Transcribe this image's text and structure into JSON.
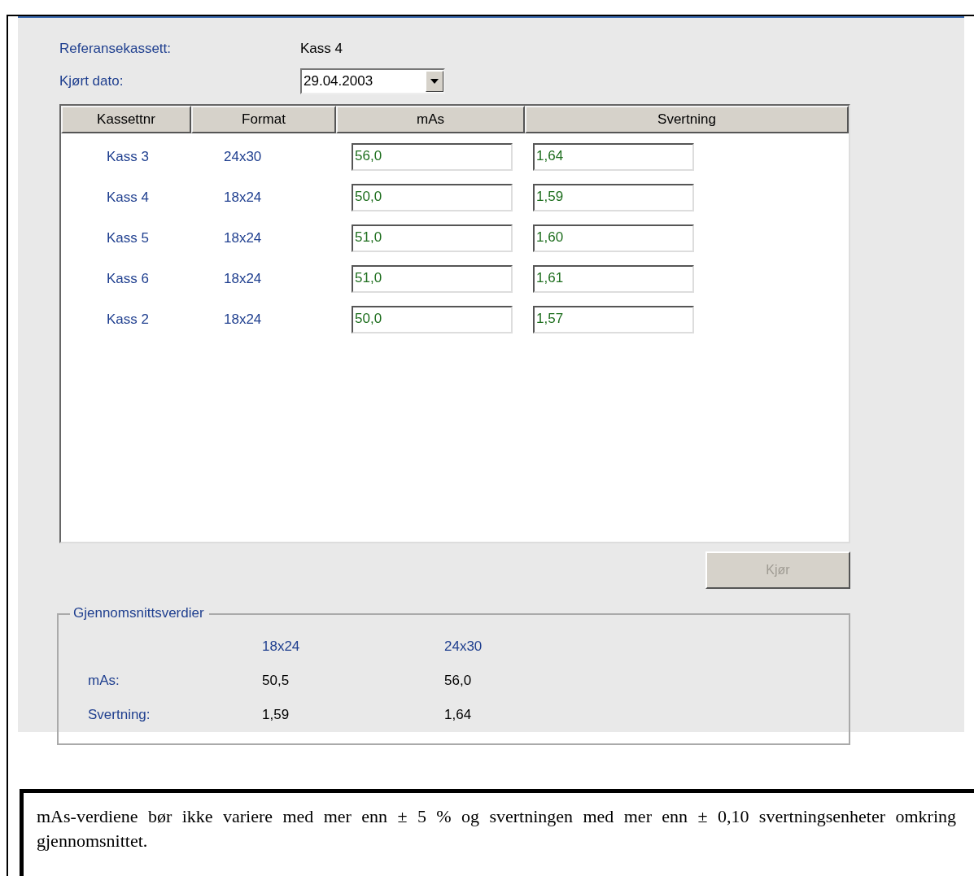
{
  "reference": {
    "label": "Referansekassett:",
    "value": "Kass 4"
  },
  "run_date": {
    "label": "Kjørt dato:",
    "value": "29.04.2003"
  },
  "table": {
    "columns": [
      "Kassettnr",
      "Format",
      "mAs",
      "Svertning"
    ],
    "rows": [
      {
        "cassette": "Kass 3",
        "format": "24x30",
        "mas": "56,0",
        "density": "1,64"
      },
      {
        "cassette": "Kass 4",
        "format": "18x24",
        "mas": "50,0",
        "density": "1,59"
      },
      {
        "cassette": "Kass 5",
        "format": "18x24",
        "mas": "51,0",
        "density": "1,60"
      },
      {
        "cassette": "Kass 6",
        "format": "18x24",
        "mas": "51,0",
        "density": "1,61"
      },
      {
        "cassette": "Kass 2",
        "format": "18x24",
        "mas": "50,0",
        "density": "1,57"
      }
    ]
  },
  "run_button": {
    "label": "Kjør",
    "disabled": true
  },
  "averages": {
    "title": "Gjennomsnittsverdier",
    "columns": [
      "18x24",
      "24x30"
    ],
    "rows": [
      {
        "label": "mAs:",
        "values": [
          "50,5",
          "56,0"
        ]
      },
      {
        "label": "Svertning:",
        "values": [
          "1,59",
          "1,64"
        ]
      }
    ]
  },
  "note": "mAs-verdiene bør ikke variere med mer enn ± 5 % og svertningen med mer enn ± 0,10 svertningsenheter omkring gjennomsnittet."
}
